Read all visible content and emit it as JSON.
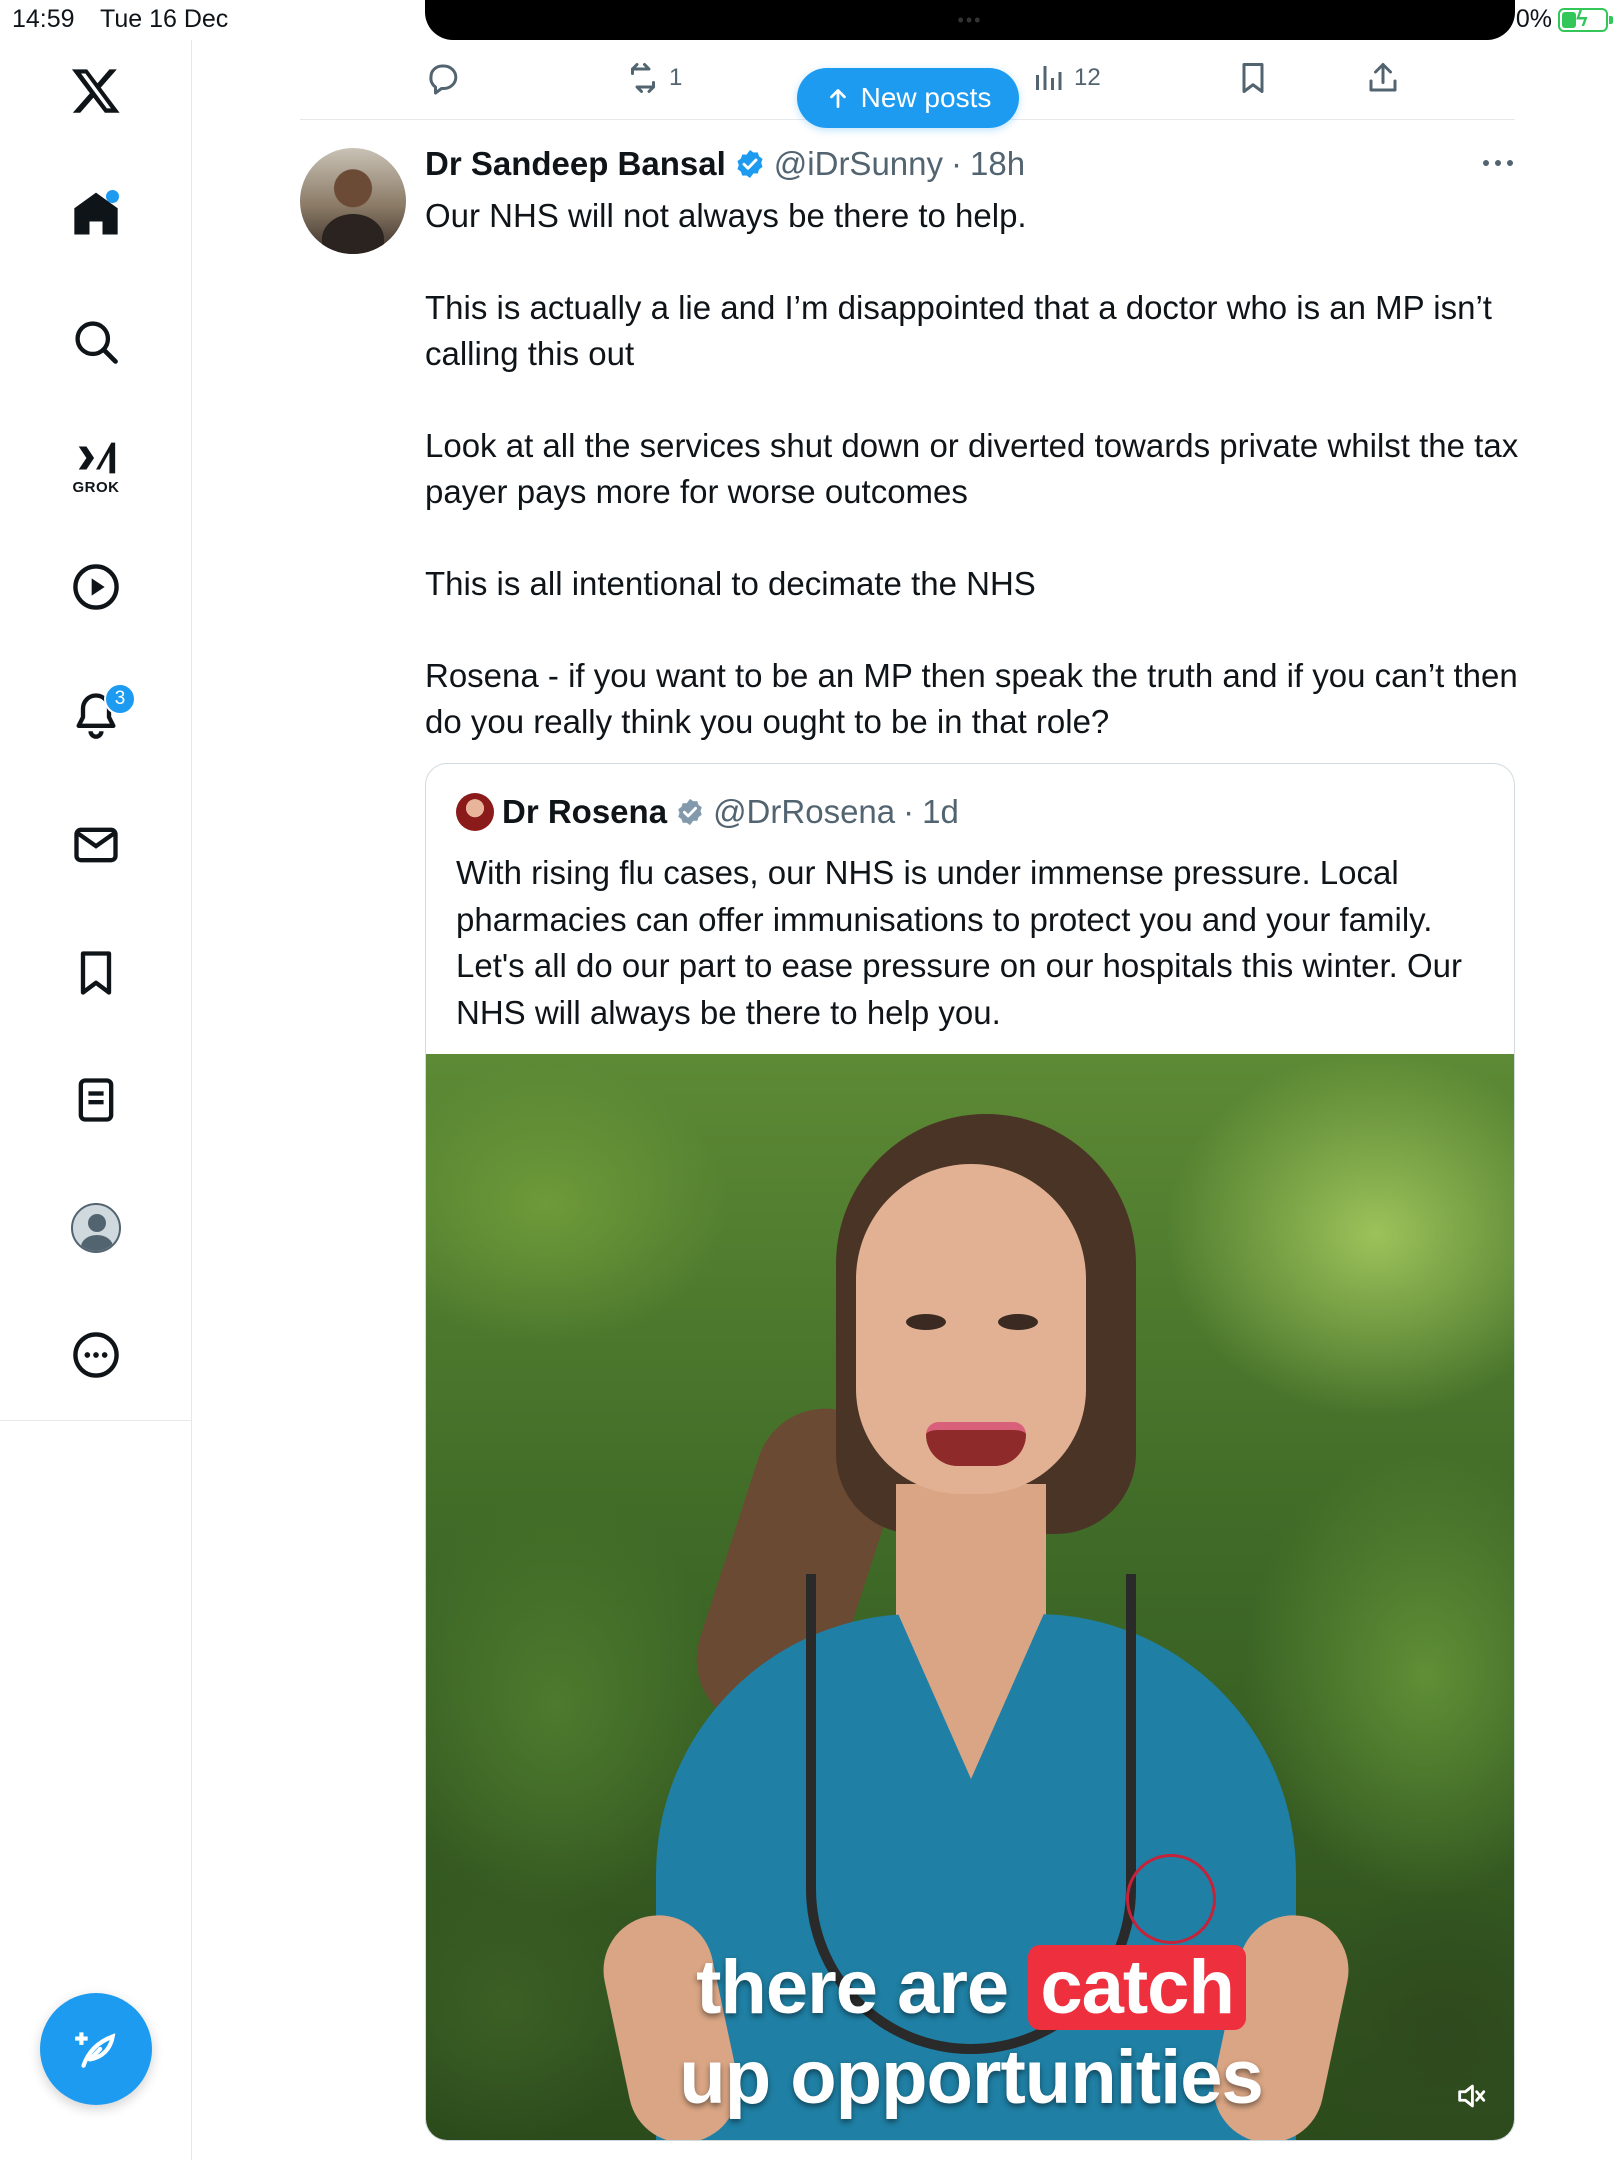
{
  "status_bar": {
    "time": "14:59",
    "date": "Tue 16 Dec",
    "battery_percent": "0%"
  },
  "sidebar": {
    "items": [
      {
        "name": "x-logo",
        "icon": "x-logo-icon"
      },
      {
        "name": "home",
        "icon": "home-icon",
        "has_dot": true
      },
      {
        "name": "explore",
        "icon": "search-icon"
      },
      {
        "name": "grok",
        "icon": "grok-icon",
        "label": "GROK"
      },
      {
        "name": "video",
        "icon": "play-icon"
      },
      {
        "name": "notifications",
        "icon": "bell-icon",
        "badge": "3"
      },
      {
        "name": "messages",
        "icon": "envelope-icon"
      },
      {
        "name": "bookmarks",
        "icon": "bookmark-icon"
      },
      {
        "name": "articles",
        "icon": "document-icon"
      },
      {
        "name": "profile",
        "icon": "avatar-icon"
      },
      {
        "name": "more",
        "icon": "more-circle-icon"
      }
    ],
    "compose_icon": "compose-icon"
  },
  "prev_post_actions": {
    "reply_count": "",
    "repost_count": "1",
    "views_count": "12"
  },
  "new_posts": {
    "label": "New posts"
  },
  "tweet": {
    "author_name": "Dr Sandeep Bansal",
    "handle": "@iDrSunny",
    "separator": "·",
    "time_ago": "18h",
    "paragraphs": [
      "Our NHS will not always be there to help.",
      "This is actually a lie and I’m disappointed that a doctor who is an MP isn’t calling this out",
      "Look at all the services shut down or diverted towards private whilst the tax payer pays more for worse outcomes",
      "This is all intentional to decimate the NHS",
      "Rosena - if you want to be an MP then speak the truth and if you can’t then do you really think you ought to be in that role?"
    ]
  },
  "quoted_tweet": {
    "author_name": "Dr Rosena",
    "handle": "@DrRosena",
    "separator": "·",
    "time_ago": "1d",
    "body": "With rising flu cases, our NHS is under immense pressure. Local pharmacies can offer immunisations to protect you and your family. Let's all do our part to ease pressure on our hospitals this winter. Our NHS will always be there to help you.",
    "video": {
      "caption_line1_a": "there are",
      "caption_line1_b": "catch",
      "caption_line2": "up opportunities",
      "muted": true
    }
  },
  "colors": {
    "accent": "#1d9bf0",
    "text_primary": "#0f1419",
    "text_secondary": "#536471",
    "caption_highlight": "#ee2f3e"
  }
}
